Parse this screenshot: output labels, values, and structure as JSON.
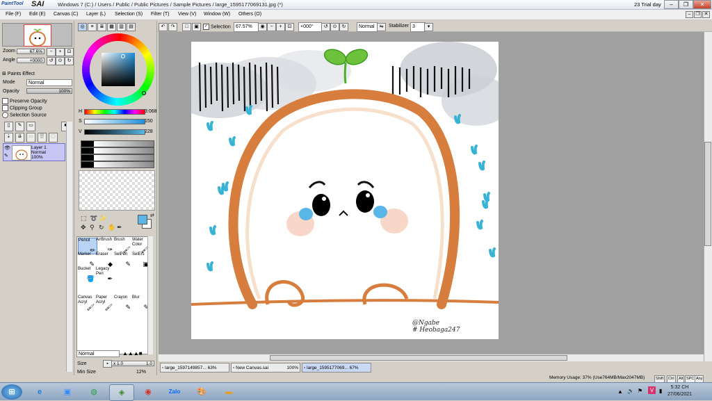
{
  "app": {
    "logo_prefix": "PaintTool",
    "logo_name": "SAI",
    "window_title": "Windows 7 (C:) / Users / Public / Public Pictures / Sample Pictures / large_1595177069131.jpg (*)",
    "trial_text": "23 Trial day"
  },
  "menu": [
    "File (F)",
    "Edit (E)",
    "Canvas (C)",
    "Layer (L)",
    "Selection (S)",
    "Filter (T)",
    "View (V)",
    "Window (W)",
    "Others (O)"
  ],
  "toolbar": {
    "selection_label": "Selection",
    "zoom_value": "67.57%",
    "angle_value": "+000°",
    "mode_value": "Normal",
    "stabilizer_label": "Stabilizer",
    "stabilizer_value": "3"
  },
  "navigator": {
    "zoom_label": "Zoom",
    "zoom_value": "67.6%",
    "angle_label": "Angle",
    "angle_value": "+0000"
  },
  "layer_panel": {
    "paints_effect": "Paints Effect",
    "mode_label": "Mode",
    "mode_value": "Normal",
    "opacity_label": "Opacity",
    "opacity_value": "100%",
    "preserve_opacity": "Preserve Opacity",
    "clipping_group": "Clipping Group",
    "selection_source": "Selection Source",
    "layer_name": "Layer 1",
    "layer_mode": "Normal",
    "layer_opacity": "100%"
  },
  "color": {
    "h_label": "H",
    "h_value": "3:068",
    "s_label": "S",
    "s_value": "150",
    "v_label": "V",
    "v_value": "228",
    "foreground": "#5ab6e6"
  },
  "brushes": [
    {
      "label": "Pencil",
      "selected": true
    },
    {
      "label": "AirBrush"
    },
    {
      "label": "Brush"
    },
    {
      "label": "Water Color"
    },
    {
      "label": "Marker"
    },
    {
      "label": "Eraser"
    },
    {
      "label": "SelPen"
    },
    {
      "label": "SelErs"
    },
    {
      "label": "Bucket"
    },
    {
      "label": "Legacy Pen"
    },
    {
      "label": "Canvas Acryl"
    },
    {
      "label": "Paper Acryl"
    },
    {
      "label": "Crayon"
    },
    {
      "label": "Blur"
    }
  ],
  "brush_settings": {
    "blend_value": "Normal",
    "size_label": "Size",
    "size_mult": "x 1.0",
    "size_value": "1.0",
    "min_size_label": "Min Size",
    "min_size_value": "12%"
  },
  "artwork": {
    "signature_line1": "@Ngabe",
    "signature_line2": "# Heobaga247"
  },
  "tabs": [
    {
      "name": "large_1597149857...",
      "zoom": "63%"
    },
    {
      "name": "New Canvas.sai",
      "zoom": "100%"
    },
    {
      "name": "large_1595177069...",
      "zoom": "67%",
      "active": true
    }
  ],
  "status": {
    "memory": "Memory Usage: 37% (Use764MB/Max2047MB)",
    "keys": [
      "Shift",
      "Ctrl",
      "Alt",
      "SPC",
      "Any"
    ]
  },
  "taskbar": {
    "icons": [
      "start-orb",
      "internet-explorer",
      "zoom",
      "gallery",
      "paint-tool-sai",
      "chrome",
      "zalo",
      "paint",
      "file-explorer"
    ],
    "time": "5:32 CH",
    "date": "27/06/2021"
  }
}
